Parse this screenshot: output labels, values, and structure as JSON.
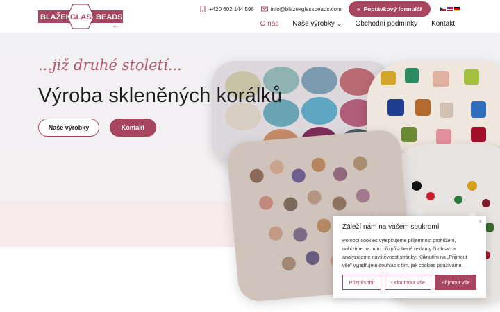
{
  "header": {
    "logo": {
      "word1": "BLAŽEK",
      "word2": "GLASS",
      "word3": "BEADS",
      "sub": "s.r.o."
    },
    "phone": "+420 602 144 596",
    "email": "info@blazekglassbeads.com",
    "cta_label": "Poptávkový formulář",
    "nav": [
      {
        "label": "O nás"
      },
      {
        "label": "Naše výrobky"
      },
      {
        "label": "Obchodní podmínky"
      },
      {
        "label": "Kontakt"
      }
    ]
  },
  "hero": {
    "tagline": "...již druhé století...",
    "title": "Výroba skleněných korálků",
    "btn_products": "Naše výrobky",
    "btn_contact": "Kontakt"
  },
  "cookie": {
    "title": "Záleží nám na vašem soukromí",
    "text": "Pomocí cookies vylepšujeme příjemnost prohlížení, nabízíme na míru přizpůsobené reklamy či obsah a analyzujeme návštěvnost stránky. Kliknutím na „Přijmout vše\" vyjadřujete souhlas s tím, jak cookies používáme.",
    "btn_customize": "Přizpůsobit",
    "btn_reject": "Odmítnout vše",
    "btn_accept": "Přijmout vše",
    "close": "×"
  },
  "colors": {
    "accent": "#a8465f"
  }
}
